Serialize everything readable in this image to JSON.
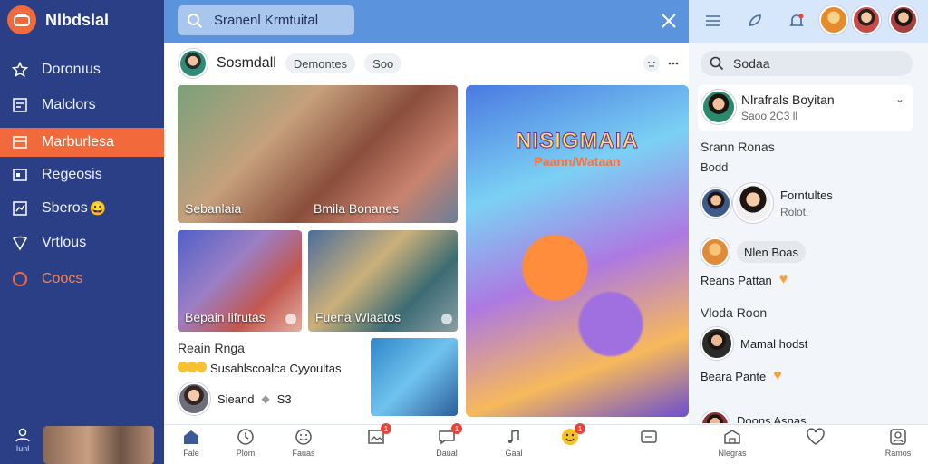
{
  "app": {
    "name": "Nlbdslal"
  },
  "sidebar": {
    "items": [
      {
        "label": "Doronıus",
        "icon": "star-icon"
      },
      {
        "label": "Malclors",
        "icon": "grid-icon"
      },
      {
        "label": "Marburlesa",
        "icon": "layout-icon",
        "active": true
      },
      {
        "label": "Regeosis",
        "icon": "card-icon"
      },
      {
        "label": "Sberos",
        "icon": "chart-icon",
        "emoji": "😀"
      },
      {
        "label": "Vrtlous",
        "icon": "shield-icon"
      },
      {
        "label": "Coocs",
        "icon": "circle-icon",
        "accent": true
      }
    ],
    "bottom_home": "Iunl"
  },
  "topbar": {
    "search_text": "Sranenl Krmtuital"
  },
  "post": {
    "author": "Sosmdall",
    "chips": [
      "Demontes",
      "Soo"
    ],
    "photo_captions": [
      "Sebanlaia",
      "Bmila Bonanes",
      "Bepain lifrutas",
      "Fuena Wlaatos"
    ],
    "poster_title": "NISIGMAIA",
    "poster_sub": "Paann/Wataan",
    "reacts_title": "Reain  Rnga",
    "reacts_text": "Susahlscoalca Cyyoultas",
    "share_name": "Sieand",
    "share_count": "S3"
  },
  "bottom_nav": [
    {
      "label": "Fale",
      "icon": "home-icon"
    },
    {
      "label": "Plom",
      "icon": "clock-icon"
    },
    {
      "label": "Fauas",
      "icon": "smile-icon"
    },
    {
      "label": "",
      "icon": "image-icon",
      "badge": "1"
    },
    {
      "label": "Daual",
      "icon": "chat-icon",
      "badge": "1"
    },
    {
      "label": "Gaal",
      "icon": "music-icon"
    },
    {
      "label": "",
      "icon": "emoji-icon",
      "badge": "1"
    },
    {
      "label": "",
      "icon": "gallery-icon"
    },
    {
      "label": "Nlegras",
      "icon": "store-icon"
    },
    {
      "label": "",
      "icon": "heart-icon"
    },
    {
      "label": "Ramos",
      "icon": "profile-icon"
    }
  ],
  "right_panel": {
    "search_text": "Sodaa",
    "profile_name": "Nlrafrals Boyitan",
    "profile_sub": "Saoo 2C3 ll",
    "section1": "Srann Ronas",
    "sub1": "Bodd",
    "friend_name": "Forntultes",
    "friend_sub": "Rolot.",
    "pill_text": "Nlen Boas",
    "row1": "Reans Pattan",
    "section2": "Vloda Roon",
    "person2": "Mamal hodst",
    "row2": "Beara Pante",
    "row3": "Doons Asnas"
  },
  "colors": {
    "sidebar": "#2a3f86",
    "accent": "#f26a3c",
    "topbar": "#5b93dd",
    "right_top": "#d6e6fb"
  }
}
